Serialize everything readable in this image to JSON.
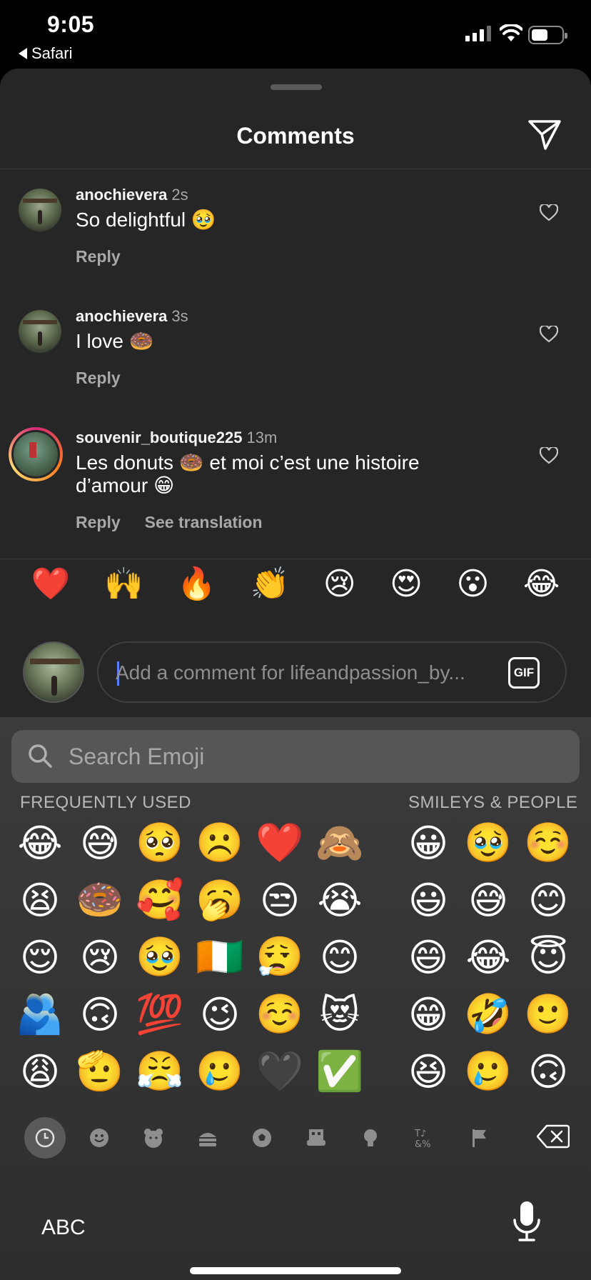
{
  "status_bar": {
    "time": "9:05",
    "back_app": "Safari"
  },
  "header": {
    "title": "Comments",
    "send_icon": "paper-plane-icon"
  },
  "comments": [
    {
      "username": "anochievera",
      "time": "2s",
      "text": "So delightful 🥹",
      "reply": "Reply"
    },
    {
      "username": "anochievera",
      "time": "3s",
      "text": "I love 🍩",
      "reply": "Reply"
    },
    {
      "username": "souvenir_boutique225",
      "time": "13m",
      "text": "Les donuts 🍩 et moi c’est une histoire d’amour 😁",
      "reply": "Reply",
      "translation": "See translation"
    }
  ],
  "quick_emojis": [
    "❤️",
    "🙌",
    "🔥",
    "👏",
    "😢",
    "😍",
    "😮",
    "😂"
  ],
  "composer": {
    "placeholder": "Add a comment for lifeandpassion_by...",
    "gif_label": "GIF"
  },
  "emoji_keyboard": {
    "search_placeholder": "Search Emoji",
    "frequently_used_label": "FREQUENTLY USED",
    "smileys_label": "SMILEYS & PEOPLE",
    "frequently_used": [
      "😂",
      "😅",
      "🥺",
      "☹️",
      "❤️",
      "🙈",
      "😫",
      "🍩",
      "🥰",
      "🥱",
      "😒",
      "😭",
      "😌",
      "😢",
      "🥹",
      "🇨🇮",
      "😮‍💨",
      "😊",
      "🫂",
      "🙃",
      "💯",
      "😉",
      "☺️",
      "😻",
      "😩",
      "🫡",
      "😤",
      "🥲",
      "🖤",
      "✅"
    ],
    "smileys": [
      "😀",
      "🥹",
      "☺️",
      "😃",
      "😅",
      "😊",
      "😄",
      "😂",
      "😇",
      "😁",
      "🤣",
      "🙂",
      "😆",
      "🥲",
      "🙃"
    ],
    "categories": [
      "clock-icon",
      "smiley-icon",
      "bear-icon",
      "food-icon",
      "ball-icon",
      "building-icon",
      "bulb-icon",
      "symbols-icon",
      "flag-icon"
    ],
    "abc_label": "ABC"
  }
}
